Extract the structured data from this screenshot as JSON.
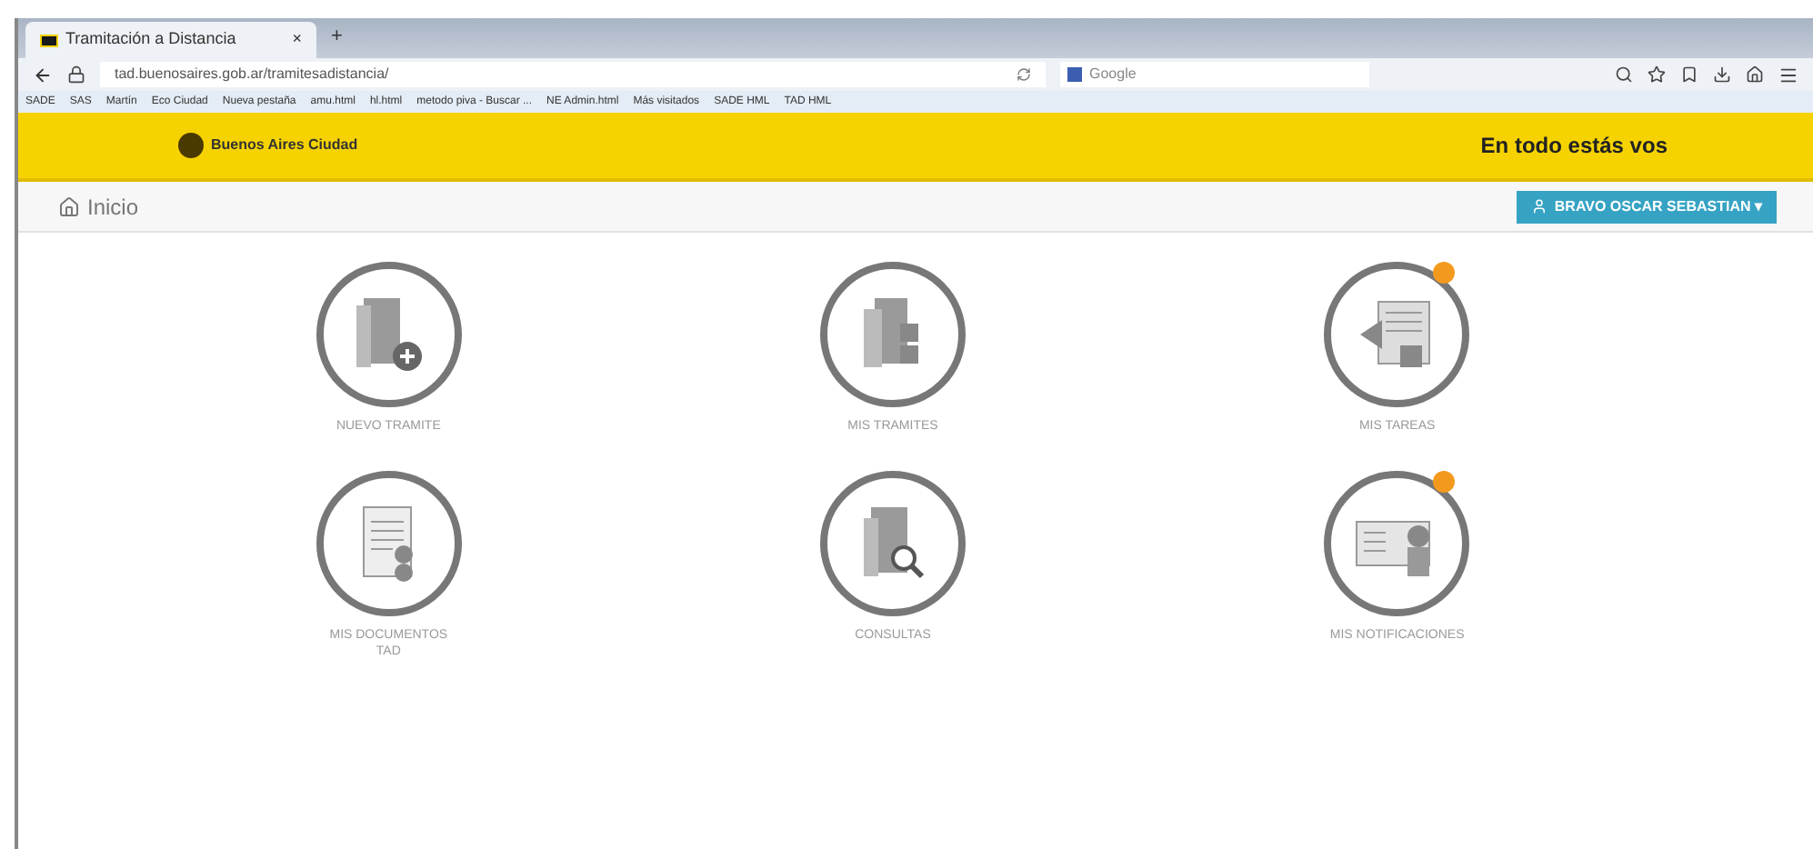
{
  "browser": {
    "tab_title": "Tramitación a Distancia",
    "tab_close": "×",
    "new_tab": "+",
    "url": "tad.buenosaires.gob.ar/tramitesadistancia/",
    "search_placeholder": "Google",
    "bookmarks": [
      "SADE",
      "SAS",
      "Martín",
      "Eco Ciudad",
      "Nueva pestaña",
      "amu.html",
      "hl.html",
      "metodo piva - Buscar ...",
      "NE Admin.html",
      "Más visitados",
      "SADE HML",
      "TAD HML"
    ]
  },
  "header": {
    "logo_text": "Buenos Aires Ciudad",
    "slogan": "En todo estás vos"
  },
  "nav": {
    "home": "Inicio",
    "user_button": "BRAVO OSCAR SEBASTIAN ▾"
  },
  "tiles": [
    {
      "label": "NUEVO TRAMITE",
      "kind": "new",
      "badge": false
    },
    {
      "label": "MIS TRAMITES",
      "kind": "folders",
      "badge": false
    },
    {
      "label": "MIS TAREAS",
      "kind": "tasks",
      "badge": true
    },
    {
      "label": "MIS DOCUMENTOS TAD",
      "kind": "documents",
      "badge": false
    },
    {
      "label": "CONSULTAS",
      "kind": "search",
      "badge": false
    },
    {
      "label": "MIS NOTIFICACIONES",
      "kind": "notifications",
      "badge": true
    }
  ]
}
